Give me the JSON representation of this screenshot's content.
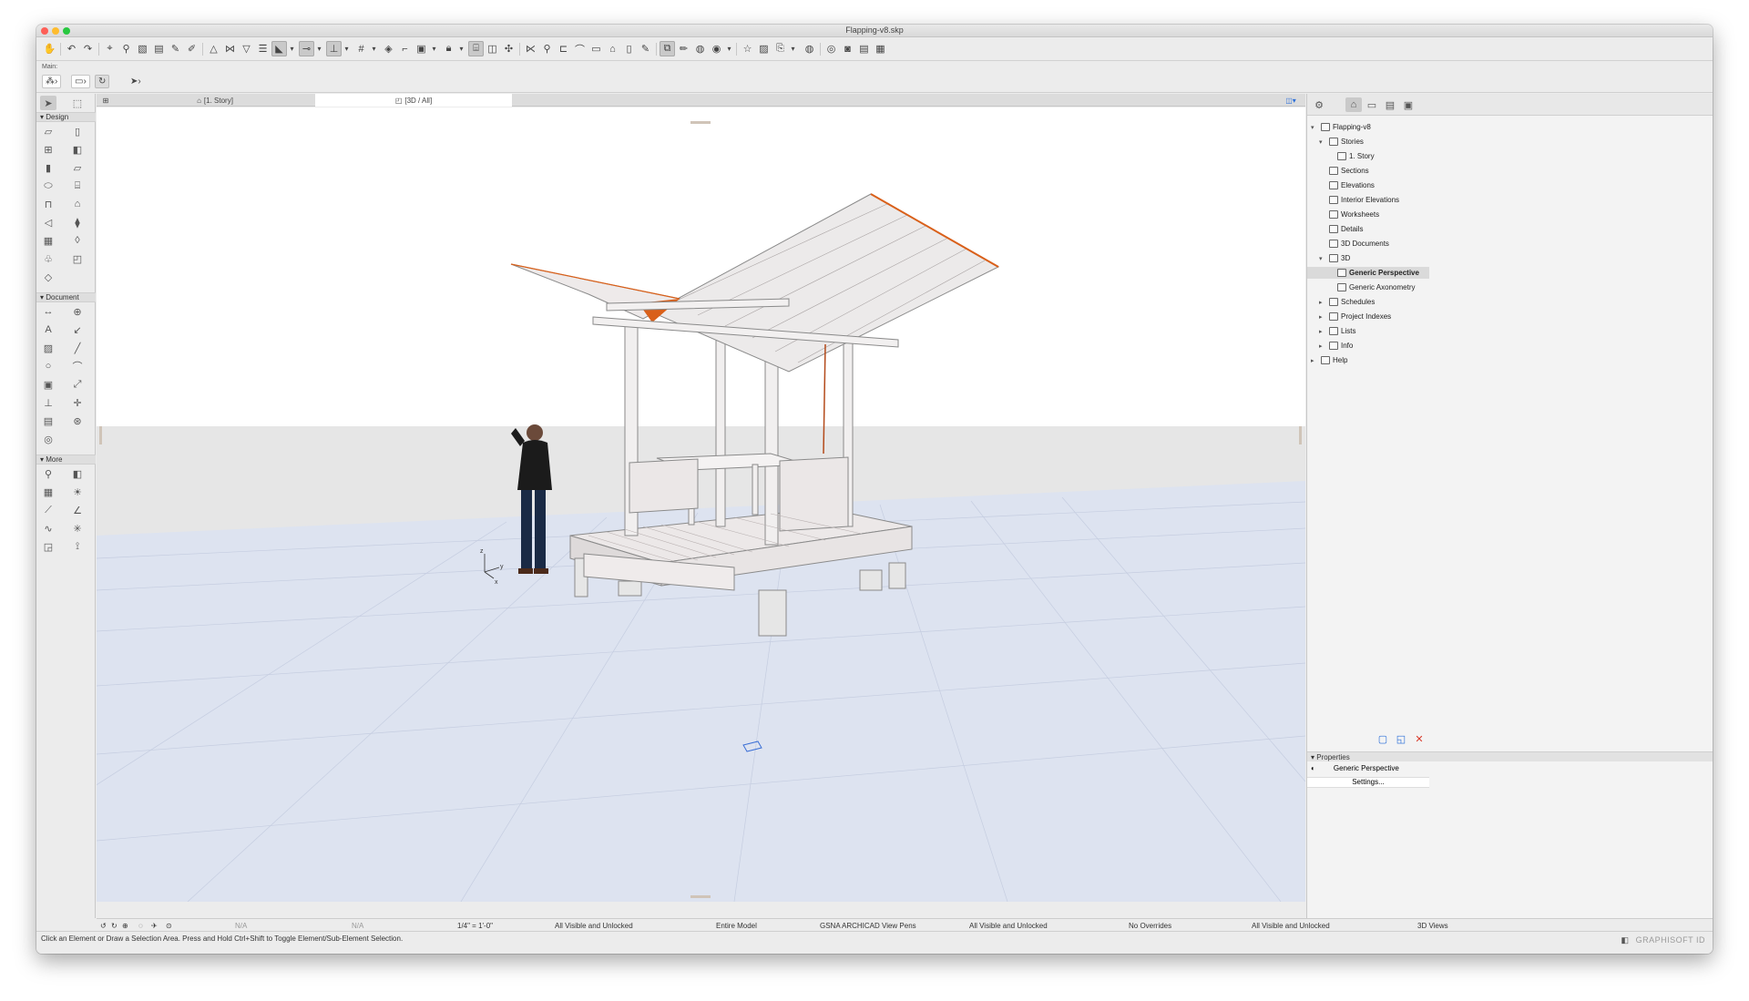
{
  "window": {
    "title": "Flapping-v8.skp"
  },
  "colors": {
    "accent": "#d9601a",
    "selection": "#3b82f6",
    "ground": "#e6ebf5"
  },
  "toolbar": {
    "label": "Main:"
  },
  "toolbox": {
    "sections": [
      "Design",
      "Document",
      "More"
    ]
  },
  "tabs": [
    {
      "label": "[1. Story]"
    },
    {
      "label": "[3D / All]"
    }
  ],
  "navigator": {
    "tree": [
      {
        "label": "Flapping-v8",
        "level": 0,
        "expanded": true
      },
      {
        "label": "Stories",
        "level": 1,
        "expanded": true
      },
      {
        "label": "1. Story",
        "level": 2
      },
      {
        "label": "Sections",
        "level": 1
      },
      {
        "label": "Elevations",
        "level": 1
      },
      {
        "label": "Interior Elevations",
        "level": 1
      },
      {
        "label": "Worksheets",
        "level": 1
      },
      {
        "label": "Details",
        "level": 1
      },
      {
        "label": "3D Documents",
        "level": 1
      },
      {
        "label": "3D",
        "level": 1,
        "expanded": true
      },
      {
        "label": "Generic Perspective",
        "level": 2,
        "selected": true
      },
      {
        "label": "Generic Axonometry",
        "level": 2
      },
      {
        "label": "Schedules",
        "level": 1,
        "collapsed": true
      },
      {
        "label": "Project Indexes",
        "level": 1,
        "collapsed": true
      },
      {
        "label": "Lists",
        "level": 1,
        "collapsed": true
      },
      {
        "label": "Info",
        "level": 1,
        "collapsed": true
      },
      {
        "label": "Help",
        "level": 0,
        "collapsed": true
      }
    ],
    "properties": {
      "title": "Properties",
      "view_name": "Generic Perspective",
      "settings_button": "Settings..."
    }
  },
  "axes": {
    "z": "z",
    "y": "y",
    "x": "x"
  },
  "quick_options": {
    "na1": "N/A",
    "na2": "N/A",
    "scale": "1/4\"   =   1'-0\"",
    "layers": "All Visible and Unlocked",
    "model": "Entire Model",
    "pens": "GSNA ARCHICAD View Pens",
    "layers2": "All Visible and Unlocked",
    "overrides": "No Overrides",
    "renovation": "All Visible and Unlocked",
    "views": "3D Views"
  },
  "status": {
    "text": "Click an Element or Draw a Selection Area. Press and Hold Ctrl+Shift to Toggle Element/Sub-Element Selection.",
    "brand": "GRAPHISOFT ID"
  }
}
